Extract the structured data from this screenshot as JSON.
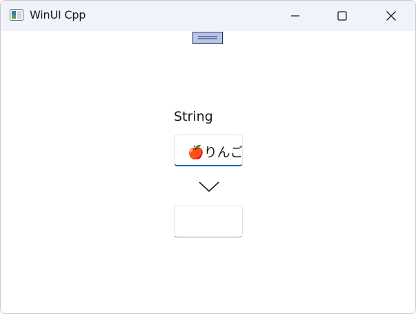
{
  "window": {
    "title": "WinUI Cpp",
    "icon": "app-window-icon",
    "buttons": {
      "minimize": "minimize-icon",
      "maximize": "maximize-icon",
      "close": "close-icon"
    }
  },
  "main": {
    "string_label": "String",
    "input_value": "りんご",
    "input_emoji": "🍎",
    "output_value": "",
    "arrow_icon": "chevron-down-icon"
  },
  "colors": {
    "titlebar": "#f0f3f9",
    "accent": "#0a63b0",
    "apple": "#e53935"
  }
}
